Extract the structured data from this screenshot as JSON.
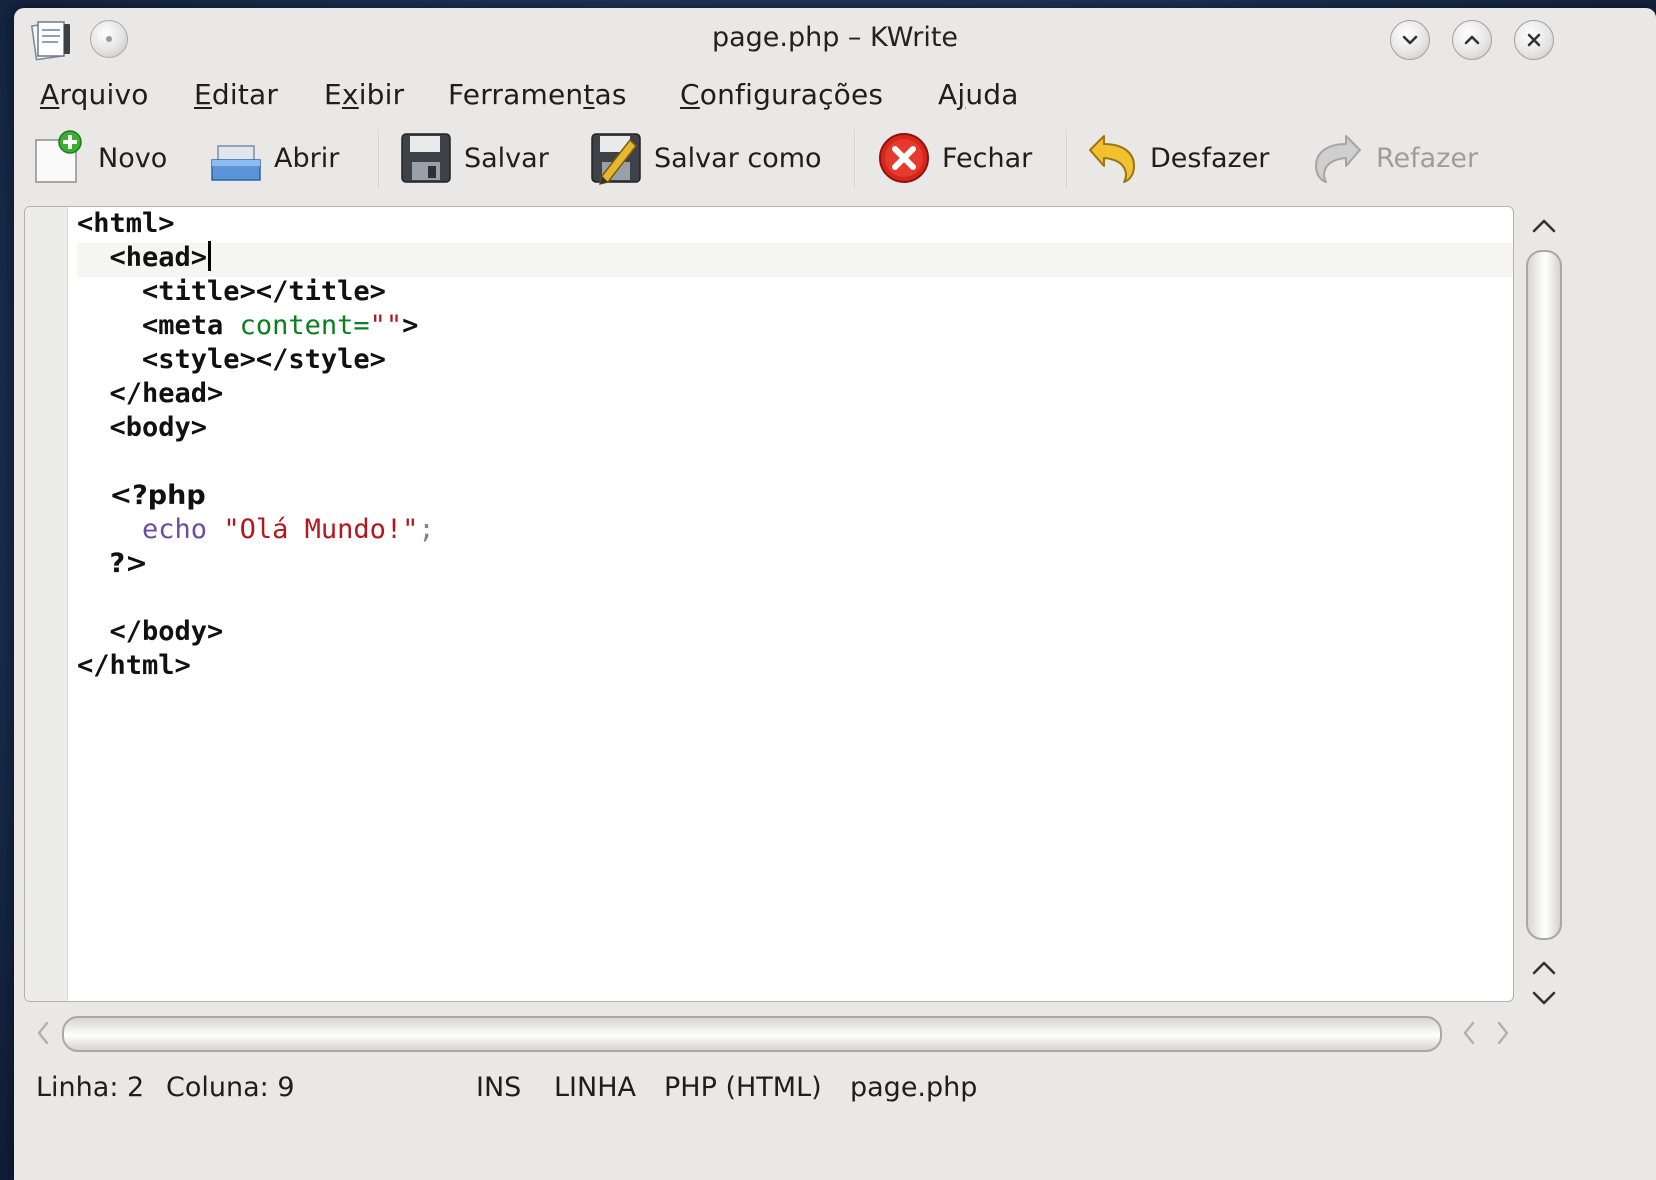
{
  "window": {
    "title": "page.php – KWrite"
  },
  "menu": [
    {
      "label": "Arquivo",
      "mnemonic_index": 0
    },
    {
      "label": "Editar",
      "mnemonic_index": 0
    },
    {
      "label": "Exibir",
      "mnemonic_index": 1
    },
    {
      "label": "Ferramentas",
      "mnemonic_index": 8
    },
    {
      "label": "Configurações",
      "mnemonic_index": 0
    },
    {
      "label": "Ajuda",
      "mnemonic_index": 1
    }
  ],
  "toolbar": {
    "novo": {
      "label": "Novo",
      "icon": "new-document-icon"
    },
    "abrir": {
      "label": "Abrir",
      "icon": "open-folder-icon"
    },
    "salvar": {
      "label": "Salvar",
      "icon": "floppy-disk-icon"
    },
    "salvar_como": {
      "label": "Salvar como",
      "icon": "save-as-icon"
    },
    "fechar": {
      "label": "Fechar",
      "icon": "close-document-icon"
    },
    "desfazer": {
      "label": "Desfazer",
      "icon": "undo-icon"
    },
    "refazer": {
      "label": "Refazer",
      "icon": "redo-icon",
      "disabled": true
    }
  },
  "editor": {
    "cursor_line": 2,
    "lines": [
      [
        {
          "t": "<html>",
          "c": "tag"
        }
      ],
      [
        {
          "t": "  "
        },
        {
          "t": "<head>",
          "c": "tag"
        }
      ],
      [
        {
          "t": "    "
        },
        {
          "t": "<title></title>",
          "c": "tag"
        }
      ],
      [
        {
          "t": "    "
        },
        {
          "t": "<meta",
          "c": "tag"
        },
        {
          "t": " "
        },
        {
          "t": "content=",
          "c": "attr"
        },
        {
          "t": "\"\"",
          "c": "str"
        },
        {
          "t": ">",
          "c": "tag"
        }
      ],
      [
        {
          "t": "    "
        },
        {
          "t": "<style></style>",
          "c": "tag"
        }
      ],
      [
        {
          "t": "  "
        },
        {
          "t": "</head>",
          "c": "tag"
        }
      ],
      [
        {
          "t": "  "
        },
        {
          "t": "<body>",
          "c": "tag"
        }
      ],
      [
        {
          "t": ""
        }
      ],
      [
        {
          "t": "  "
        },
        {
          "t": "<?php",
          "c": "phptag"
        }
      ],
      [
        {
          "t": "    "
        },
        {
          "t": "echo",
          "c": "kw"
        },
        {
          "t": " "
        },
        {
          "t": "\"Olá Mundo!\"",
          "c": "str"
        },
        {
          "t": ";",
          "c": "punct"
        }
      ],
      [
        {
          "t": "  "
        },
        {
          "t": "?>",
          "c": "phptag"
        }
      ],
      [
        {
          "t": ""
        }
      ],
      [
        {
          "t": "  "
        },
        {
          "t": "</body>",
          "c": "tag"
        }
      ],
      [
        {
          "t": "</html>",
          "c": "tag"
        }
      ]
    ]
  },
  "status": {
    "linha": "Linha: 2",
    "coluna": "Coluna: 9",
    "mode": "INS",
    "selection": "LINHA",
    "syntax": "PHP (HTML)",
    "filename": "page.php"
  },
  "colors": {
    "tag": "#111111",
    "attribute": "#0a7f1f",
    "string": "#b5161b",
    "keyword": "#6b4f9e",
    "window_bg": "#e9e8e6"
  }
}
